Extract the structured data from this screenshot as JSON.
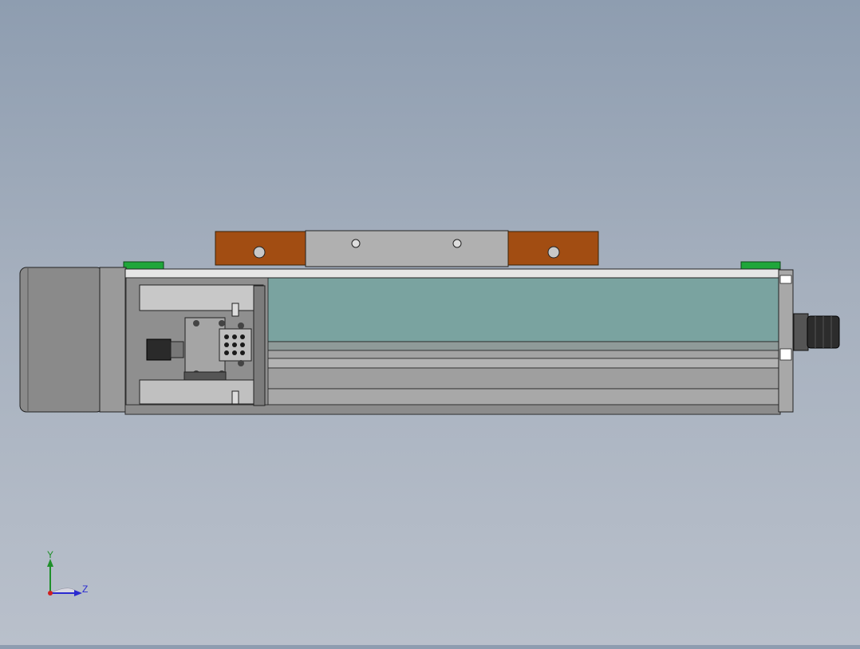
{
  "triad": {
    "y_label": "Y",
    "z_label": "Z"
  },
  "colors": {
    "background_top": "#8e9db0",
    "background_bottom": "#b9c0cb",
    "motor_body": "#8a8a8a",
    "profile_body": "#9a9a9a",
    "cover_teal": "#7aa3a0",
    "bracket_orange": "#a24d12",
    "foot_green": "#1fa63a",
    "triad_y": "#1f8f2a",
    "triad_z": "#2a2ad0",
    "triad_x": "#d02020"
  }
}
